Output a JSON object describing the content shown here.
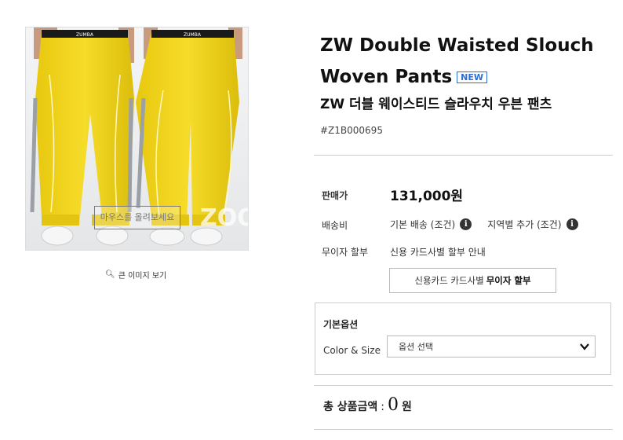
{
  "product": {
    "title": "ZW Double Waisted Slouch Woven Pants",
    "badge": "NEW",
    "subtitle": "ZW 더블 웨이스티드 슬라우치 우븐 팬츠",
    "code": "#Z1B000695",
    "image_hint": "마우스를 올려보세요",
    "image_watermark": "ZOO",
    "zoom_link": "큰 이미지 보기",
    "waistband_text": "ZUMBA"
  },
  "pricing": {
    "price_label": "판매가",
    "price_value": "131,000원",
    "shipping_label": "배송비",
    "shipping_basic": "기본 배송 (조건)",
    "shipping_regional": "지역별 추가 (조건)",
    "installment_label": "무이자 할부",
    "installment_info": "신용 카드사별 할부 안내",
    "installment_button_prefix": "신용카드 카드사별",
    "installment_button_bold": "무이자 할부"
  },
  "options": {
    "section_title": "기본옵션",
    "color_size_label": "Color & Size",
    "select_value": "옵션 선택"
  },
  "total": {
    "label": "총 상품금액",
    "separator": ":",
    "amount": "0",
    "unit": "원"
  },
  "colors": {
    "pants_yellow": "#f2d31b",
    "badge_blue": "#2a6fd6"
  }
}
